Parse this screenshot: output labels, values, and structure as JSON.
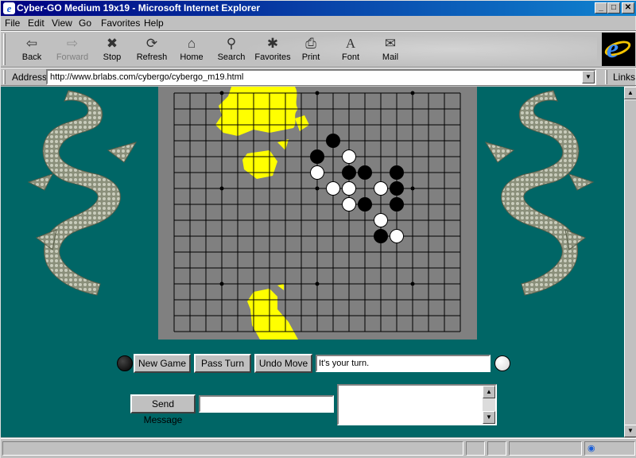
{
  "window": {
    "title": "Cyber-GO Medium 19x19 - Microsoft Internet Explorer",
    "controls": {
      "minimize": "_",
      "maximize": "□",
      "close": "✕"
    }
  },
  "menu": {
    "items": [
      {
        "label": "File"
      },
      {
        "label": "Edit"
      },
      {
        "label": "View"
      },
      {
        "label": "Go"
      },
      {
        "label": "Favorites"
      },
      {
        "label": "Help"
      }
    ]
  },
  "toolbar": {
    "buttons": [
      {
        "label": "Back",
        "icon": "back-arrow-icon",
        "glyph": "⇦"
      },
      {
        "label": "Forward",
        "icon": "forward-arrow-icon",
        "glyph": "⇨"
      },
      {
        "label": "Stop",
        "icon": "stop-icon",
        "glyph": "✖"
      },
      {
        "label": "Refresh",
        "icon": "refresh-icon",
        "glyph": "⟳"
      },
      {
        "label": "Home",
        "icon": "home-icon",
        "glyph": "⌂"
      },
      {
        "label": "Search",
        "icon": "search-icon",
        "glyph": "⚲"
      },
      {
        "label": "Favorites",
        "icon": "favorites-folder-icon",
        "glyph": "✱"
      },
      {
        "label": "Print",
        "icon": "printer-icon",
        "glyph": "⎙"
      },
      {
        "label": "Font",
        "icon": "font-icon",
        "glyph": "A"
      },
      {
        "label": "Mail",
        "icon": "mail-icon",
        "glyph": "✉"
      }
    ]
  },
  "address": {
    "label": "Address",
    "url": "http://www.brlabs.com/cybergo/cybergo_m19.html",
    "links_label": "Links"
  },
  "game": {
    "board_size": 19,
    "black_stones": [
      [
        10,
        8
      ],
      [
        11,
        7
      ],
      [
        12,
        9
      ],
      [
        13,
        9
      ],
      [
        15,
        9
      ],
      [
        15,
        10
      ],
      [
        13,
        11
      ],
      [
        15,
        11
      ],
      [
        14,
        13
      ]
    ],
    "white_stones": [
      [
        10,
        9
      ],
      [
        12,
        8
      ],
      [
        11,
        10
      ],
      [
        12,
        10
      ],
      [
        14,
        10
      ],
      [
        12,
        11
      ],
      [
        14,
        12
      ],
      [
        15,
        13
      ]
    ],
    "new_game_label": "New Game",
    "pass_turn_label": "Pass Turn",
    "undo_move_label": "Undo Move",
    "status_text": "It's your turn.",
    "send_message_label": "Send Message",
    "message_value": "",
    "chat_value": "",
    "colors": {
      "background": "#006666",
      "board": "#808080",
      "highlight": "#ffff00"
    }
  }
}
